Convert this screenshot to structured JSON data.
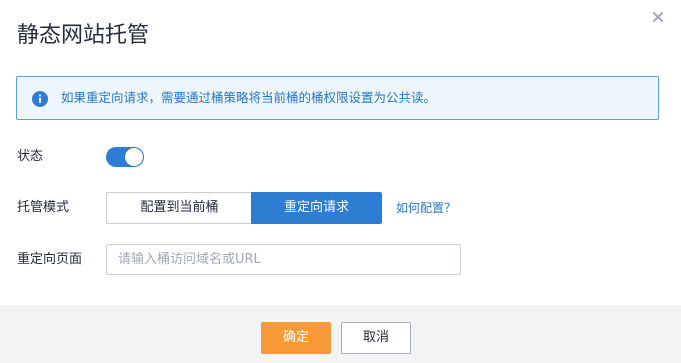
{
  "dialog": {
    "title": "静态网站托管",
    "close_icon": "close-icon"
  },
  "notice": {
    "icon": "info-icon",
    "text": "如果重定向请求，需要通过桶策略将当前桶的桶权限设置为公共读。"
  },
  "status": {
    "label": "状态",
    "enabled": true
  },
  "hosting_mode": {
    "label": "托管模式",
    "options": [
      "配置到当前桶",
      "重定向请求"
    ],
    "selected": "重定向请求",
    "help_link": "如何配置？"
  },
  "redirect_page": {
    "label": "重定向页面",
    "value": "",
    "placeholder": "请输入桶访问域名或URL"
  },
  "footer": {
    "ok_label": "确定",
    "cancel_label": "取消"
  },
  "colors": {
    "accent": "#2d7dd2",
    "primary_button": "#f69a37",
    "notice_border": "#5e9edb",
    "notice_bg": "#eef6fd"
  }
}
